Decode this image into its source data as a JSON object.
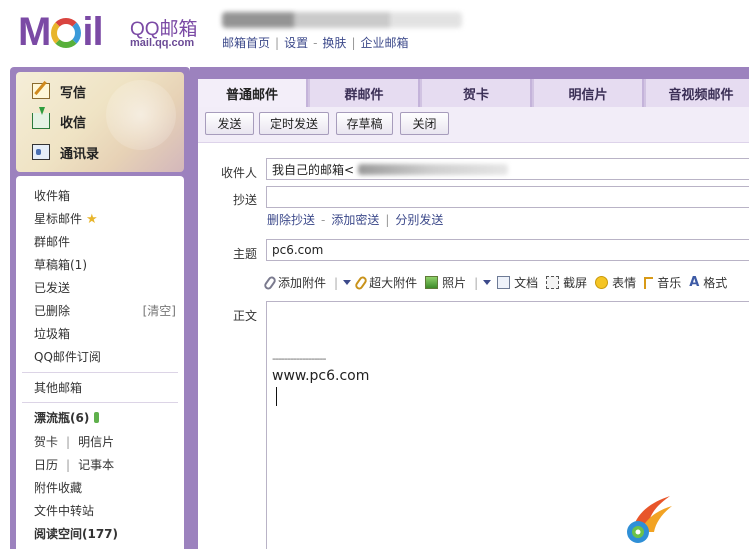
{
  "header": {
    "logo_text": "M",
    "logo_qq": "QQ邮箱",
    "logo_url": "mail.qq.com",
    "links": [
      "邮箱首页",
      "设置",
      "换肤",
      "企业邮箱"
    ]
  },
  "sidebar": {
    "quick": [
      {
        "label": "写信",
        "icon": "compose-icon"
      },
      {
        "label": "收信",
        "icon": "inbox-download-icon"
      },
      {
        "label": "通讯录",
        "icon": "contacts-icon"
      }
    ],
    "folders": {
      "inbox": "收件箱",
      "starred": "星标邮件",
      "group": "群邮件",
      "drafts": "草稿箱(1)",
      "sent": "已发送",
      "deleted": "已删除",
      "clear": "[清空]",
      "spam": "垃圾箱",
      "subscribe": "QQ邮件订阅",
      "other": "其他邮箱",
      "bottle": "漂流瓶(6)",
      "card": "贺卡",
      "postcard": "明信片",
      "calendar": "日历",
      "notes": "记事本",
      "attach_fav": "附件收藏",
      "transfer": "文件中转站",
      "reading": "阅读空间(177)"
    }
  },
  "tabs": [
    "普通邮件",
    "群邮件",
    "贺卡",
    "明信片",
    "音视频邮件"
  ],
  "toolbar": {
    "send": "发送",
    "scheduled": "定时发送",
    "save_draft": "存草稿",
    "close": "关闭"
  },
  "compose": {
    "to_label": "收件人",
    "to_value": "我自己的邮箱<",
    "cc_label": "抄送",
    "cc_links": [
      "删除抄送",
      "添加密送",
      "分别发送"
    ],
    "subject_label": "主题",
    "subject_value": "pc6.com",
    "attach_bar": {
      "add_attach": "添加附件",
      "big_attach": "超大附件",
      "photo": "照片",
      "doc": "文档",
      "screenshot": "截屏",
      "emoji": "表情",
      "music": "音乐",
      "format": "格式"
    },
    "body_label": "正文",
    "signature_line": "------------------",
    "signature_text": "www.pc6.com"
  },
  "colors": {
    "brand_purple": "#7b4aa5",
    "frame_purple": "#9c82be",
    "tab_active": "#f3eef9"
  }
}
